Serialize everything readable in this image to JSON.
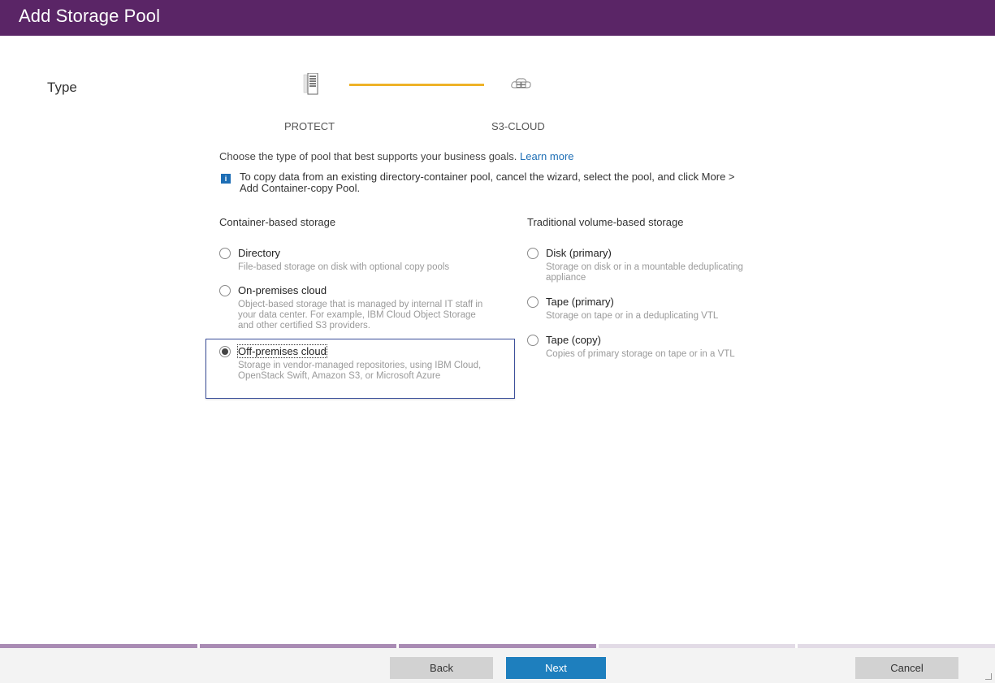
{
  "window": {
    "title": "Add Storage Pool"
  },
  "wizard": {
    "current_step": "Type",
    "stepper": [
      {
        "label": "PROTECT",
        "icon": "server-icon"
      },
      {
        "label": "S3-CLOUD",
        "icon": "cloud-storage-icon"
      }
    ]
  },
  "content": {
    "intro_text": "Choose the type of pool that best supports your business goals.",
    "learn_more_link": "Learn more",
    "info_message": "To copy data from an existing directory-container pool, cancel the wizard, select the pool, and click More > Add Container-copy Pool.",
    "info_icon_glyph": "i"
  },
  "columns": {
    "container": {
      "heading": "Container-based storage",
      "options": [
        {
          "label": "Directory",
          "description": "File-based storage on disk with optional copy pools",
          "selected": false
        },
        {
          "label": "On-premises cloud",
          "description": "Object-based storage that is managed by internal IT staff in your data center. For example, IBM Cloud Object Storage and other certified S3 providers.",
          "selected": false
        },
        {
          "label": "Off-premises cloud",
          "description": "Storage in vendor-managed repositories, using IBM Cloud, OpenStack Swift, Amazon S3, or Microsoft Azure",
          "selected": true
        }
      ]
    },
    "traditional": {
      "heading": "Traditional volume-based storage",
      "options": [
        {
          "label": "Disk (primary)",
          "description": "Storage on disk or in a mountable deduplicating appliance",
          "selected": false
        },
        {
          "label": "Tape (primary)",
          "description": "Storage on tape or in a deduplicating VTL",
          "selected": false
        },
        {
          "label": "Tape (copy)",
          "description": "Copies of primary storage on tape or in a VTL",
          "selected": false
        }
      ]
    }
  },
  "progress": {
    "total_steps": 5,
    "completed_steps": 3,
    "color_done": "#a98bb4",
    "color_todo": "#e2dbe6"
  },
  "footer": {
    "back_label": "Back",
    "next_label": "Next",
    "cancel_label": "Cancel"
  },
  "colors": {
    "titlebar": "#5a2566",
    "accent_line": "#eeb228",
    "primary_button": "#1e7fbe",
    "link": "#1d6eb5"
  }
}
